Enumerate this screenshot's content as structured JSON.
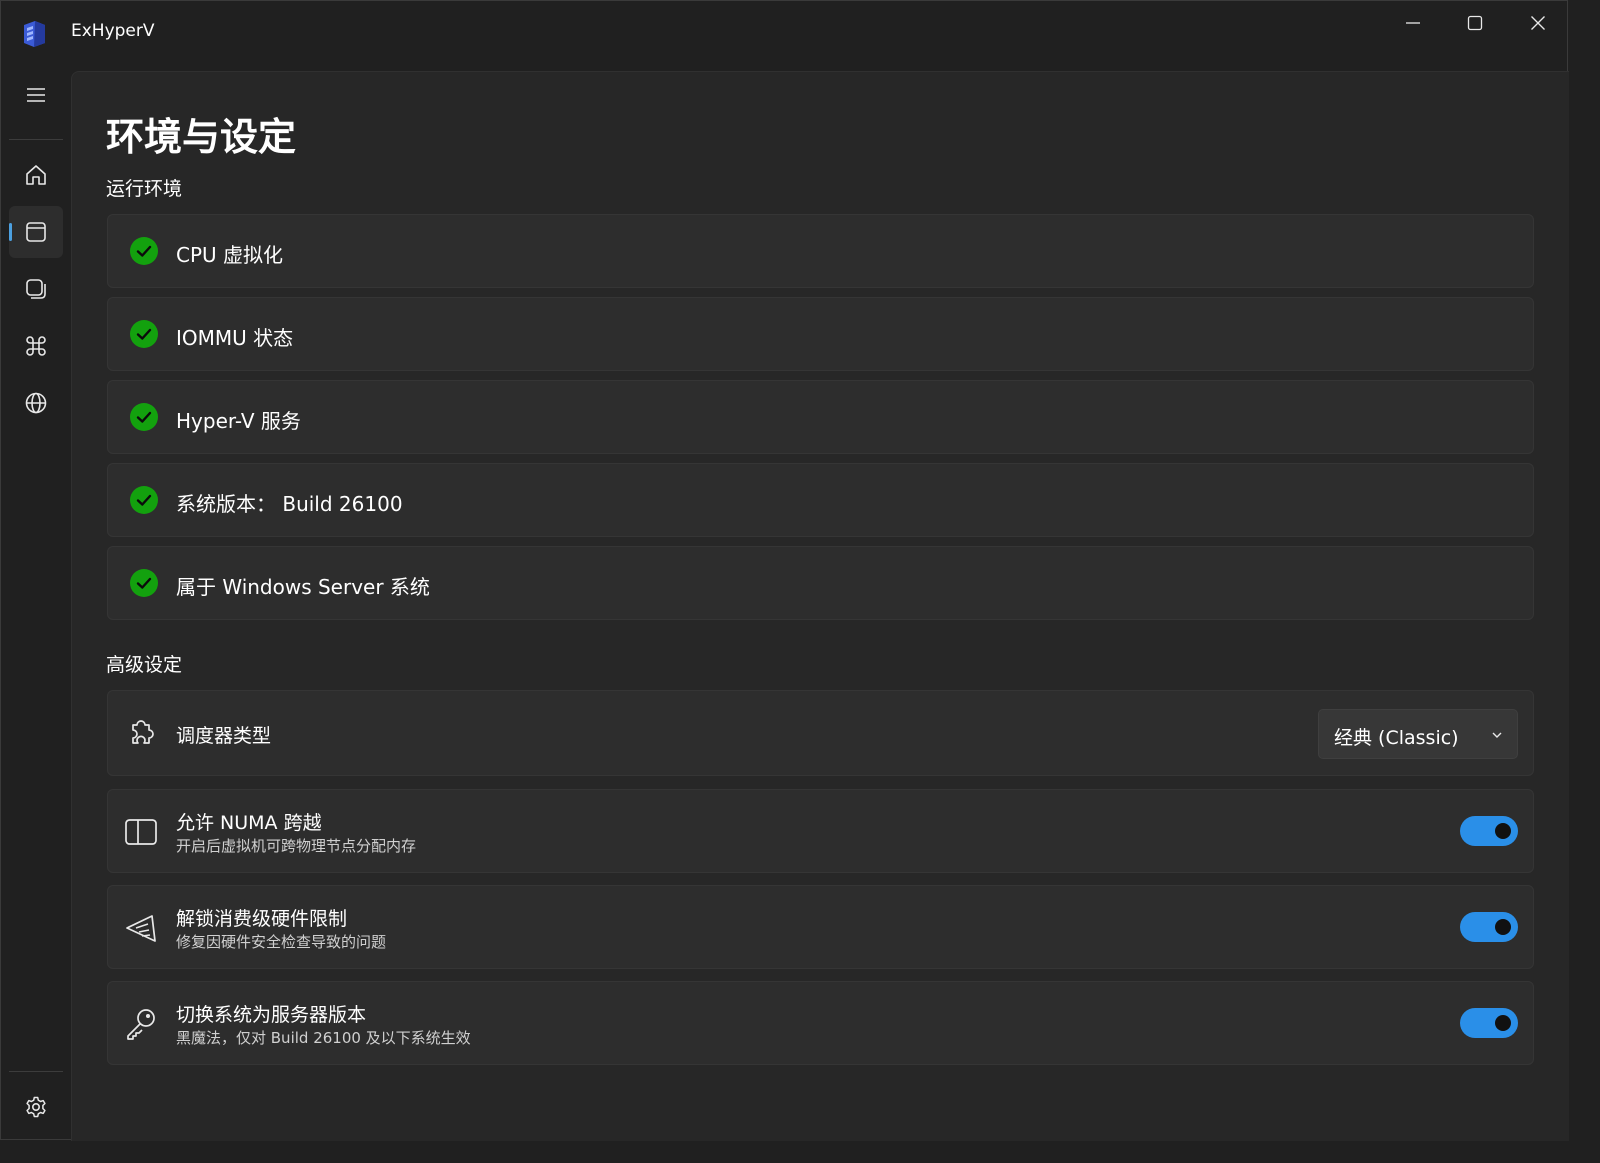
{
  "window": {
    "title": "ExHyperV"
  },
  "sidebar": {
    "items": [
      {
        "name": "home",
        "icon": "home-icon",
        "active": false
      },
      {
        "name": "environment",
        "icon": "window-icon",
        "active": true
      },
      {
        "name": "vm",
        "icon": "stacked-squares-icon",
        "active": false
      },
      {
        "name": "command",
        "icon": "command-icon",
        "active": false
      },
      {
        "name": "network",
        "icon": "globe-icon",
        "active": false
      }
    ],
    "settings_icon": "gear-icon"
  },
  "page": {
    "title": "环境与设定",
    "runtime_section": "运行环境",
    "advanced_section": "高级设定"
  },
  "runtime": [
    {
      "label": "CPU 虚拟化",
      "status": "ok"
    },
    {
      "label": "IOMMU 状态",
      "status": "ok"
    },
    {
      "label": "Hyper-V 服务",
      "status": "ok"
    },
    {
      "label": "系统版本： Build 26100",
      "status": "ok"
    },
    {
      "label": "属于 Windows Server 系统",
      "status": "ok"
    }
  ],
  "advanced": {
    "scheduler": {
      "title": "调度器类型",
      "value": "经典 (Classic)",
      "icon": "puzzle-icon"
    },
    "numa": {
      "title": "允许 NUMA 跨越",
      "desc": "开启后虚拟机可跨物理节点分配内存",
      "enabled": true,
      "icon": "split-panel-icon"
    },
    "unlock": {
      "title": "解锁消费级硬件限制",
      "desc": "修复因硬件安全检查导致的问题",
      "enabled": true,
      "icon": "wand-icon"
    },
    "server": {
      "title": "切换系统为服务器版本",
      "desc": "黑魔法，仅对 Build 26100 及以下系统生效",
      "enabled": true,
      "icon": "key-icon"
    }
  },
  "colors": {
    "accent": "#2a8fe8",
    "check_green": "#13a10e",
    "background": "#202020",
    "card": "#2d2d2d"
  }
}
